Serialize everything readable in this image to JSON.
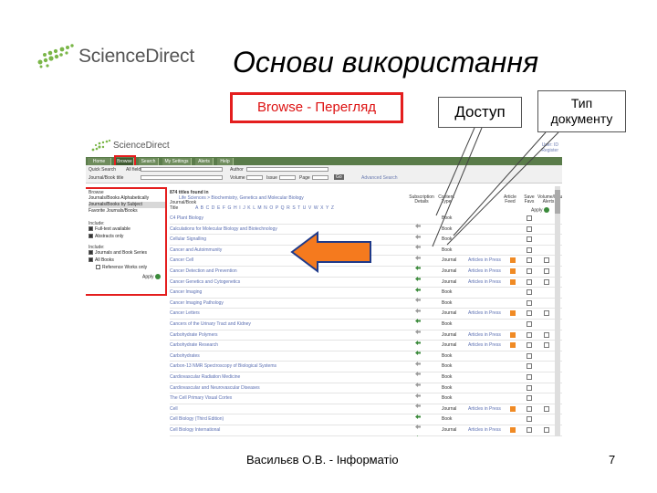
{
  "slide": {
    "title": "Основи використання",
    "logo_text": "ScienceDirect",
    "author": "Васильєв О.В. - Інформатіо",
    "page_number": "7"
  },
  "callouts": {
    "browse": "Browse - Перегляд",
    "access": "Доступ",
    "doc_type": "Тип документу"
  },
  "screenshot": {
    "logo_text": "ScienceDirect",
    "top_right": [
      "User: ID",
      "Register"
    ],
    "nav_tabs": [
      "Home",
      "Browse",
      "Search",
      "My Settings",
      "Alerts",
      "Help"
    ],
    "search": {
      "label1": "Quick Search",
      "label2": "All fields",
      "label3": "Author",
      "label4": "Journal/Book title",
      "label5": "Volume",
      "label6": "Issue",
      "label7": "Page",
      "go": "Go",
      "advanced": "Advanced Search"
    },
    "left_panel": {
      "browse_head": "Browse",
      "items": [
        "Journals/Books Alphabetically",
        "Journals/Books by Subject",
        "Favorite Journals/Books"
      ],
      "include_head": "Include:",
      "include_items": [
        "Full-text available",
        "Abstracts only"
      ],
      "include2_head": "Include:",
      "include2_items": [
        "Journals and Book Series",
        "All Books",
        "Reference Works only"
      ],
      "apply": "Apply"
    },
    "list": {
      "count_line": "874 titles found in",
      "subject_line": "Life Sciences > Biochemistry, Genetics and Molecular Biology",
      "journal_book": "Journal/Book",
      "title_label": "Title",
      "alphabet": "A B C D E F G H I J K L M N O P Q R S T U V W X Y Z",
      "col_access": "Subscription Details",
      "col_type": "Content Type",
      "col_articles": "Article Feed",
      "col_favorites": "Save Favs",
      "col_alerts": "Volume/Issue Alerts",
      "apply": "Apply"
    },
    "rows": [
      {
        "title": "C4 Plant Biology",
        "type": "Book",
        "articles": "",
        "rss": false,
        "cb1": true,
        "cb2": false
      },
      {
        "title": "Calculations for Molecular Biology and Biotechnology",
        "type": "Book",
        "articles": "",
        "rss": false,
        "cb1": true,
        "cb2": false
      },
      {
        "title": "Cellular Signalling",
        "type": "Book",
        "articles": "",
        "rss": false,
        "cb1": true,
        "cb2": false
      },
      {
        "title": "Cancer and Autoimmunity",
        "type": "Book",
        "articles": "",
        "rss": false,
        "cb1": true,
        "cb2": false
      },
      {
        "title": "Cancer Cell",
        "type": "Journal",
        "articles": "Articles in Press",
        "rss": true,
        "cb1": true,
        "cb2": true
      },
      {
        "title": "Cancer Detection and Prevention",
        "type": "Journal",
        "articles": "Articles in Press",
        "rss": true,
        "cb1": true,
        "cb2": true
      },
      {
        "title": "Cancer Genetics and Cytogenetics",
        "type": "Journal",
        "articles": "Articles in Press",
        "rss": true,
        "cb1": true,
        "cb2": true
      },
      {
        "title": "Cancer Imaging",
        "type": "Book",
        "articles": "",
        "rss": false,
        "cb1": true,
        "cb2": false
      },
      {
        "title": "Cancer Imaging Pathology",
        "type": "Book",
        "articles": "",
        "rss": false,
        "cb1": true,
        "cb2": false
      },
      {
        "title": "Cancer Letters",
        "type": "Journal",
        "articles": "Articles in Press",
        "rss": true,
        "cb1": true,
        "cb2": true
      },
      {
        "title": "Cancers of the Urinary Tract and Kidney",
        "type": "Book",
        "articles": "",
        "rss": false,
        "cb1": true,
        "cb2": false
      },
      {
        "title": "Carbohydrate Polymers",
        "type": "Journal",
        "articles": "Articles in Press",
        "rss": true,
        "cb1": true,
        "cb2": true
      },
      {
        "title": "Carbohydrate Research",
        "type": "Journal",
        "articles": "Articles in Press",
        "rss": true,
        "cb1": true,
        "cb2": true
      },
      {
        "title": "Carbohydrates",
        "type": "Book",
        "articles": "",
        "rss": false,
        "cb1": true,
        "cb2": false
      },
      {
        "title": "Carbon-13 NMR Spectroscopy of Biological Systems",
        "type": "Book",
        "articles": "",
        "rss": false,
        "cb1": true,
        "cb2": false
      },
      {
        "title": "Cardiovascular Radiation Medicine",
        "type": "Book",
        "articles": "",
        "rss": false,
        "cb1": true,
        "cb2": false
      },
      {
        "title": "Cardiovascular and Neurovascular Diseases",
        "type": "Book",
        "articles": "",
        "rss": false,
        "cb1": true,
        "cb2": false
      },
      {
        "title": "The Cell Primary Visual Cortex",
        "type": "Book",
        "articles": "",
        "rss": false,
        "cb1": true,
        "cb2": false
      },
      {
        "title": "Cell",
        "type": "Journal",
        "articles": "Articles in Press",
        "rss": true,
        "cb1": true,
        "cb2": true
      },
      {
        "title": "Cell Biology (Third Edition)",
        "type": "Book",
        "articles": "",
        "rss": false,
        "cb1": true,
        "cb2": false
      },
      {
        "title": "Cell Biology International",
        "type": "Journal",
        "articles": "Articles in Press",
        "rss": true,
        "cb1": true,
        "cb2": true
      }
    ]
  },
  "colors": {
    "highlight_red": "#e41e1e",
    "arrow_fill": "#f57a1e",
    "arrow_stroke": "#1f3a8a",
    "nav_green": "#5a7c4a",
    "link_blue": "#5b6fb2",
    "rss_orange": "#f08a24"
  }
}
